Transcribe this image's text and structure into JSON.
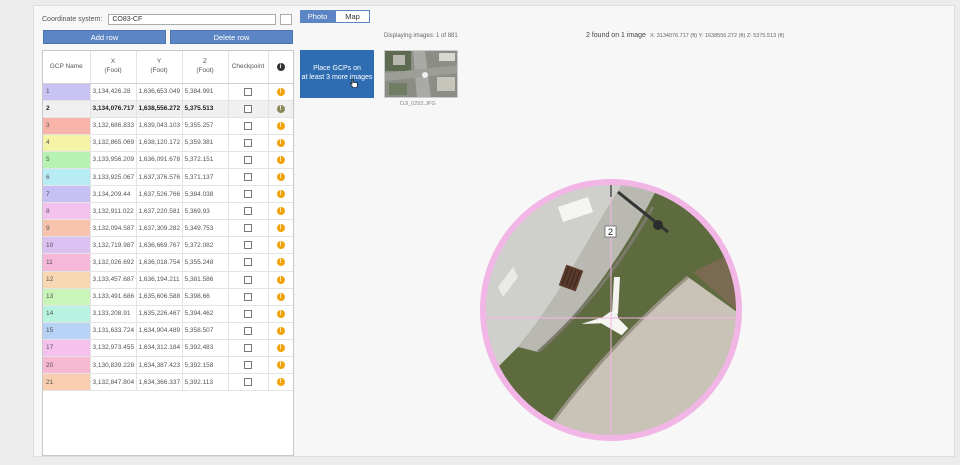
{
  "coordinate_system": {
    "label": "Coordinate system:",
    "value": "CO83-CF"
  },
  "buttons": {
    "add_row": "Add row",
    "delete_row": "Delete row"
  },
  "table": {
    "headers": {
      "gcp_name": "GCP Name",
      "x": "X",
      "x_unit": "(Foot)",
      "y": "Y",
      "y_unit": "(Foot)",
      "z": "Z",
      "z_unit": "(Foot)",
      "checkpoint": "Checkpoint"
    },
    "rows": [
      {
        "name": "1",
        "x": "3,134,426.28",
        "y": "1,636,653.049",
        "z": "5,384.991",
        "color": "#c9c3f3"
      },
      {
        "name": "2",
        "x": "3,134,076.717",
        "y": "1,638,556.272",
        "z": "5,375.513",
        "color": "#f0f0f0",
        "active": true
      },
      {
        "name": "3",
        "x": "3,132,686.833",
        "y": "1,639,043.103",
        "z": "5,355.257",
        "color": "#f8b4a8"
      },
      {
        "name": "4",
        "x": "3,132,865.069",
        "y": "1,638,120.172",
        "z": "5,359.381",
        "color": "#f5f3a6"
      },
      {
        "name": "5",
        "x": "3,133,956.209",
        "y": "1,636,091.678",
        "z": "5,372.151",
        "color": "#b6f2b2"
      },
      {
        "name": "6",
        "x": "3,133,925.067",
        "y": "1,637,376.576",
        "z": "5,371.137",
        "color": "#b8ecf5"
      },
      {
        "name": "7",
        "x": "3,134,209.44",
        "y": "1,637,526.766",
        "z": "5,384.038",
        "color": "#c7c0f5"
      },
      {
        "name": "8",
        "x": "3,132,911.022",
        "y": "1,637,220.581",
        "z": "5,369.93",
        "color": "#f4c2ee"
      },
      {
        "name": "9",
        "x": "3,132,094.587",
        "y": "1,637,309.282",
        "z": "5,349.753",
        "color": "#f8c3ad"
      },
      {
        "name": "10",
        "x": "3,132,719.987",
        "y": "1,636,669.767",
        "z": "5,372.082",
        "color": "#dcc0f2"
      },
      {
        "name": "11",
        "x": "3,132,026.692",
        "y": "1,636,018.754",
        "z": "5,355.248",
        "color": "#f6b8d8"
      },
      {
        "name": "12",
        "x": "3,133,457.687",
        "y": "1,636,194.211",
        "z": "5,381.586",
        "color": "#f8d8b2"
      },
      {
        "name": "13",
        "x": "3,133,491.686",
        "y": "1,635,606.588",
        "z": "5,398.66",
        "color": "#c9f5b8"
      },
      {
        "name": "14",
        "x": "3,133,208.91",
        "y": "1,635,226.467",
        "z": "5,394.462",
        "color": "#b8f2e0"
      },
      {
        "name": "15",
        "x": "3,131,633.724",
        "y": "1,634,904.489",
        "z": "5,358.507",
        "color": "#b8d2f5"
      },
      {
        "name": "17",
        "x": "3,132,973.455",
        "y": "1,634,312.184",
        "z": "5,392.483",
        "color": "#f5c2f0"
      },
      {
        "name": "20",
        "x": "3,130,839.228",
        "y": "1,634,387.423",
        "z": "5,392.158",
        "color": "#f7b8d2"
      },
      {
        "name": "21",
        "x": "3,132,847.804",
        "y": "1,634,366.337",
        "z": "5,392.113",
        "color": "#f8cdb0"
      }
    ]
  },
  "tabs": {
    "photo": "Photo",
    "map": "Map"
  },
  "displaying": "Displaying images: 1 of 881",
  "found": "2 found on 1 image",
  "coords_readout": "X: 3134076.717 (ft)  Y: 1638556.272 (ft)  Z: 5375.513 (ft)",
  "place_gcps": {
    "line1": "Place GCPs on",
    "line2": "at least 3 more images"
  },
  "thumbnail": {
    "caption": "DJI_0292.JPG",
    "icon": "aerial-photo-thumbnail"
  },
  "marker_label": "2",
  "colors": {
    "accent": "#5b85c4",
    "place_box": "#2f6db3",
    "warning": "#f0a30a",
    "magnifier_ring": "#f2b6e6"
  }
}
